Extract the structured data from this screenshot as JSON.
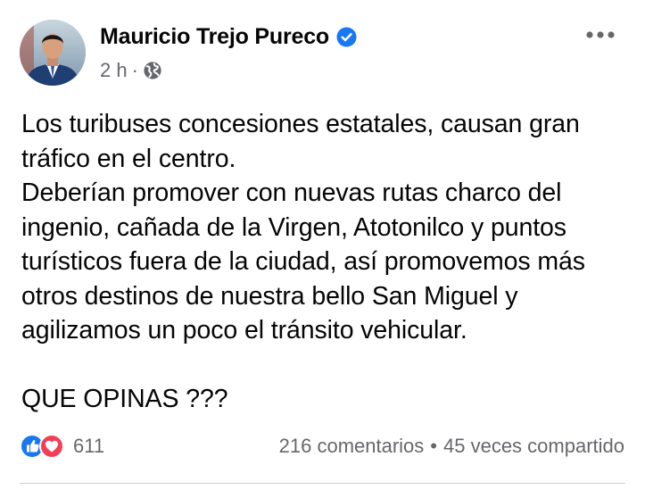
{
  "post": {
    "author": {
      "name": "Mauricio Trejo Pureco",
      "verified_icon": "verified-badge-icon"
    },
    "meta": {
      "time": "2 h",
      "separator": "·",
      "audience_icon": "globe-icon"
    },
    "more_icon": "more-options-icon",
    "text_lines": [
      "Los turibuses concesiones estatales, causan gran",
      "tráfico en el centro.",
      "Deberían promover con nuevas rutas charco del",
      "ingenio, cañada de la Virgen, Atotonilco y puntos",
      "turísticos fuera de la ciudad, así promovemos más",
      "otros destinos de nuestra bello San Miguel  y",
      "agilizamos un poco el tránsito vehicular.",
      "",
      "QUE OPINAS ???"
    ],
    "reactions": {
      "icons": [
        "like-icon",
        "love-icon"
      ],
      "count": "611"
    },
    "engagement": {
      "comments": "216 comentarios",
      "separator": "•",
      "shares": "45 veces compartido"
    }
  },
  "colors": {
    "like_blue": "#1877f2",
    "love_red": "#f33e58",
    "secondary_text": "#65676b",
    "verified_blue": "#1877f2"
  }
}
